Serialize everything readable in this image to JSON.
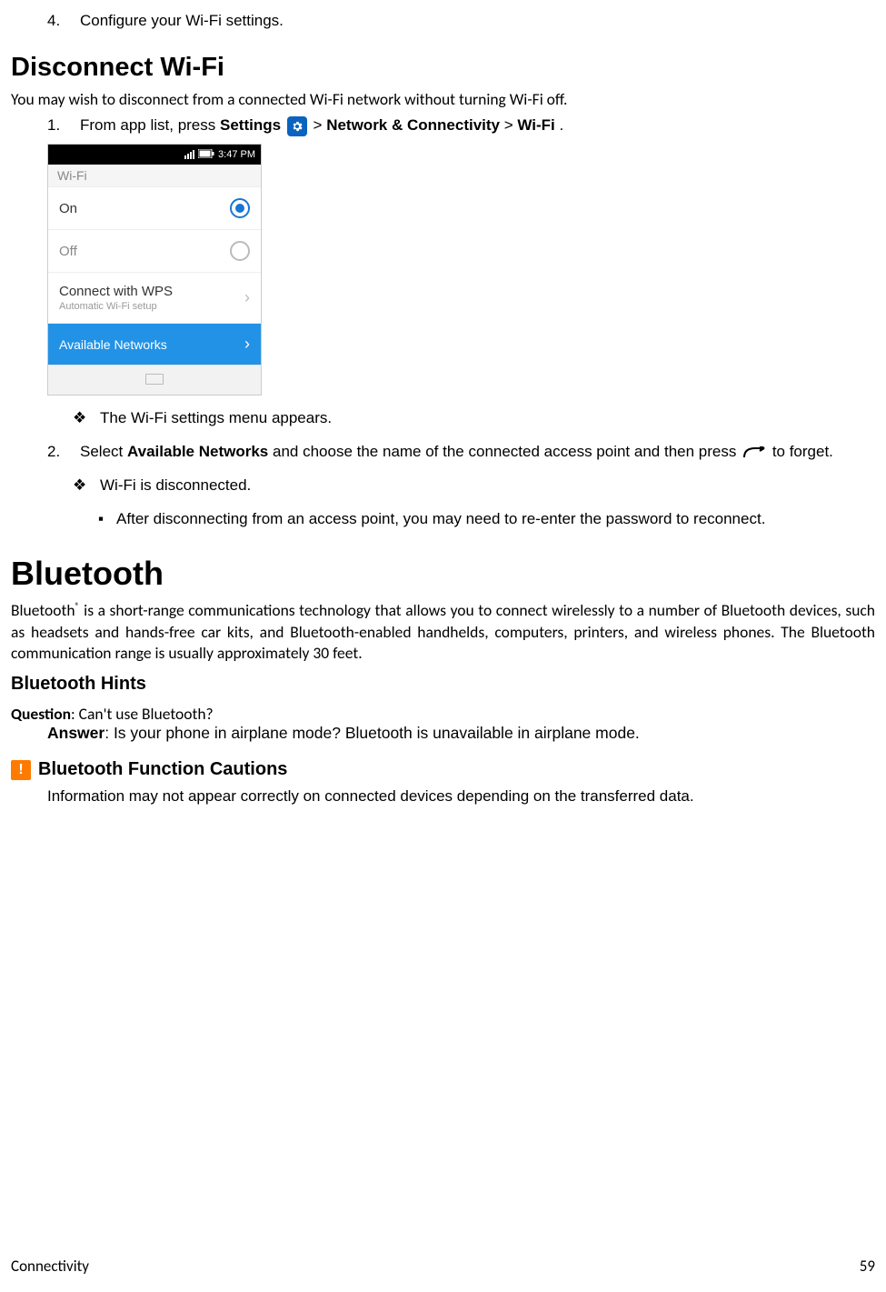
{
  "step4": {
    "num": "4.",
    "text": "Configure your Wi-Fi settings."
  },
  "h_disconnect": "Disconnect Wi-Fi",
  "p_disconnect": "You may wish to disconnect from a connected Wi-Fi network without turning Wi-Fi off.",
  "step1": {
    "num": "1.",
    "pre": "From app list, press ",
    "settings": "Settings",
    "gt1": " > ",
    "nc": "Network & Connectivity",
    "gt2": " > ",
    "wifi": "Wi-Fi",
    "dot": "."
  },
  "screenshot": {
    "time": "3:47 PM",
    "header": "Wi-Fi",
    "on": "On",
    "off": "Off",
    "wps": "Connect with WPS",
    "wps_sub": "Automatic Wi-Fi setup",
    "avail": "Available Networks"
  },
  "dia1": "The Wi-Fi settings menu appears.",
  "step2": {
    "num": "2.",
    "pre": "Select ",
    "avail": "Available Networks",
    "mid": " and choose the name of the connected access point and then press ",
    "post": " to forget."
  },
  "dia2": "Wi-Fi is disconnected.",
  "sq1": "After disconnecting from an access point, you may need to re-enter the password to reconnect.",
  "h_bluetooth": "Bluetooth",
  "p_bt": {
    "pre": "Bluetooth",
    "sup": "®",
    "rest": " is a short-range communications technology that allows you to connect wirelessly to a number of Bluetooth devices, such as headsets and hands-free car kits, and Bluetooth-enabled handhelds, computers, printers, and wireless phones. The Bluetooth communication range is usually approximately 30 feet."
  },
  "h_hints": "Bluetooth Hints",
  "qa": {
    "q_label": "Question",
    "q_text": ": Can't use Bluetooth?",
    "a_label": "Answer",
    "a_text": ": Is your phone in airplane mode? Bluetooth is unavailable in airplane mode."
  },
  "h_cautions": "Bluetooth Function Cautions",
  "p_cautions": "Information may not appear correctly on connected devices depending on the transferred data.",
  "footer": {
    "left": "Connectivity",
    "right": "59"
  }
}
